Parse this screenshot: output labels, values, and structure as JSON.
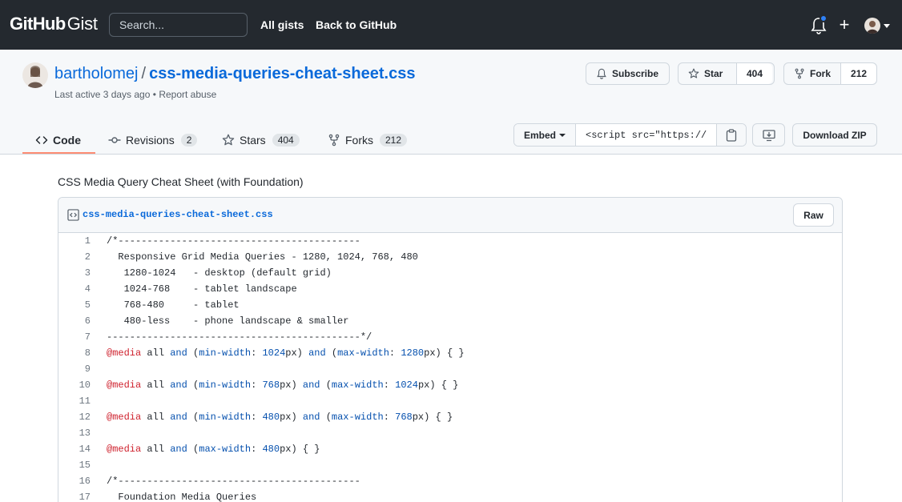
{
  "header": {
    "brand_bold": "GitHub",
    "brand_light": "Gist",
    "search_placeholder": "Search...",
    "nav": [
      "All gists",
      "Back to GitHub"
    ]
  },
  "gist": {
    "owner": "bartholomej",
    "separator": "/",
    "name": "css-media-queries-cheat-sheet.css",
    "last_active": "Last active 3 days ago",
    "bullet": "•",
    "report": "Report abuse",
    "subscribe_label": "Subscribe",
    "star_label": "Star",
    "star_count": "404",
    "fork_label": "Fork",
    "fork_count": "212"
  },
  "tabs": [
    {
      "label": "Code",
      "count": null
    },
    {
      "label": "Revisions",
      "count": "2"
    },
    {
      "label": "Stars",
      "count": "404"
    },
    {
      "label": "Forks",
      "count": "212"
    }
  ],
  "embed": {
    "select_label": "Embed",
    "value": "<script src=\"https://"
  },
  "download_label": "Download ZIP",
  "description": "CSS Media Query Cheat Sheet (with Foundation)",
  "file": {
    "name": "css-media-queries-cheat-sheet.css",
    "raw_label": "Raw",
    "lines": [
      {
        "n": "1",
        "text": "/*------------------------------------------"
      },
      {
        "n": "2",
        "text": "  Responsive Grid Media Queries - 1280, 1024, 768, 480"
      },
      {
        "n": "3",
        "text": "   1280-1024   - desktop (default grid)"
      },
      {
        "n": "4",
        "text": "   1024-768    - tablet landscape"
      },
      {
        "n": "5",
        "text": "   768-480     - tablet"
      },
      {
        "n": "6",
        "text": "   480-less    - phone landscape & smaller"
      },
      {
        "n": "7",
        "text": "--------------------------------------------*/"
      },
      {
        "n": "8",
        "media": true,
        "min": "1024",
        "max": "1280"
      },
      {
        "n": "9",
        "text": ""
      },
      {
        "n": "10",
        "media": true,
        "min": "768",
        "max": "1024"
      },
      {
        "n": "11",
        "text": ""
      },
      {
        "n": "12",
        "media": true,
        "min": "480",
        "max": "768"
      },
      {
        "n": "13",
        "text": ""
      },
      {
        "n": "14",
        "media": true,
        "max": "480"
      },
      {
        "n": "15",
        "text": ""
      },
      {
        "n": "16",
        "text": "/*------------------------------------------"
      },
      {
        "n": "17",
        "text": "  Foundation Media Queries"
      }
    ]
  }
}
